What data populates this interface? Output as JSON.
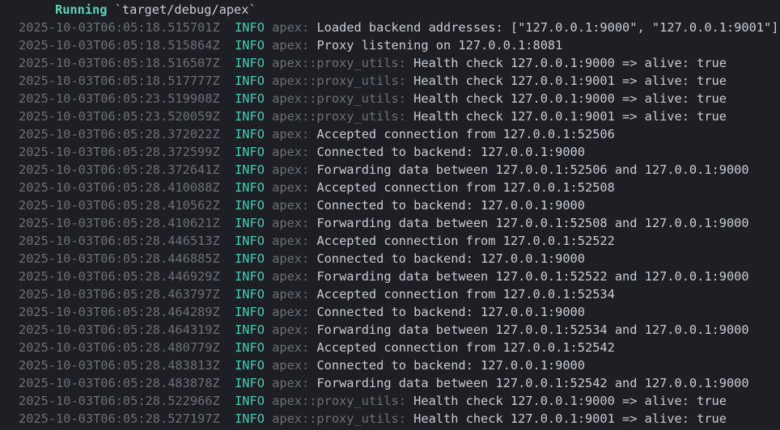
{
  "header": {
    "status": "Running",
    "command": "`target/debug/apex`"
  },
  "logs": [
    {
      "ts": "2025-10-03T06:05:18.515701Z",
      "level": "INFO",
      "target": "apex:",
      "msg": "Loaded backend addresses: [\"127.0.0.1:9000\", \"127.0.0.1:9001\"]"
    },
    {
      "ts": "2025-10-03T06:05:18.515864Z",
      "level": "INFO",
      "target": "apex:",
      "msg": "Proxy listening on 127.0.0.1:8081"
    },
    {
      "ts": "2025-10-03T06:05:18.516507Z",
      "level": "INFO",
      "target": "apex::proxy_utils:",
      "msg": "Health check 127.0.0.1:9000 => alive: true"
    },
    {
      "ts": "2025-10-03T06:05:18.517777Z",
      "level": "INFO",
      "target": "apex::proxy_utils:",
      "msg": "Health check 127.0.0.1:9001 => alive: true"
    },
    {
      "ts": "2025-10-03T06:05:23.519908Z",
      "level": "INFO",
      "target": "apex::proxy_utils:",
      "msg": "Health check 127.0.0.1:9000 => alive: true"
    },
    {
      "ts": "2025-10-03T06:05:23.520059Z",
      "level": "INFO",
      "target": "apex::proxy_utils:",
      "msg": "Health check 127.0.0.1:9001 => alive: true"
    },
    {
      "ts": "2025-10-03T06:05:28.372022Z",
      "level": "INFO",
      "target": "apex:",
      "msg": "Accepted connection from 127.0.0.1:52506"
    },
    {
      "ts": "2025-10-03T06:05:28.372599Z",
      "level": "INFO",
      "target": "apex:",
      "msg": "Connected to backend: 127.0.0.1:9000"
    },
    {
      "ts": "2025-10-03T06:05:28.372641Z",
      "level": "INFO",
      "target": "apex:",
      "msg": "Forwarding data between 127.0.0.1:52506 and 127.0.0.1:9000"
    },
    {
      "ts": "2025-10-03T06:05:28.410088Z",
      "level": "INFO",
      "target": "apex:",
      "msg": "Accepted connection from 127.0.0.1:52508"
    },
    {
      "ts": "2025-10-03T06:05:28.410562Z",
      "level": "INFO",
      "target": "apex:",
      "msg": "Connected to backend: 127.0.0.1:9000"
    },
    {
      "ts": "2025-10-03T06:05:28.410621Z",
      "level": "INFO",
      "target": "apex:",
      "msg": "Forwarding data between 127.0.0.1:52508 and 127.0.0.1:9000"
    },
    {
      "ts": "2025-10-03T06:05:28.446513Z",
      "level": "INFO",
      "target": "apex:",
      "msg": "Accepted connection from 127.0.0.1:52522"
    },
    {
      "ts": "2025-10-03T06:05:28.446885Z",
      "level": "INFO",
      "target": "apex:",
      "msg": "Connected to backend: 127.0.0.1:9000"
    },
    {
      "ts": "2025-10-03T06:05:28.446929Z",
      "level": "INFO",
      "target": "apex:",
      "msg": "Forwarding data between 127.0.0.1:52522 and 127.0.0.1:9000"
    },
    {
      "ts": "2025-10-03T06:05:28.463797Z",
      "level": "INFO",
      "target": "apex:",
      "msg": "Accepted connection from 127.0.0.1:52534"
    },
    {
      "ts": "2025-10-03T06:05:28.464289Z",
      "level": "INFO",
      "target": "apex:",
      "msg": "Connected to backend: 127.0.0.1:9000"
    },
    {
      "ts": "2025-10-03T06:05:28.464319Z",
      "level": "INFO",
      "target": "apex:",
      "msg": "Forwarding data between 127.0.0.1:52534 and 127.0.0.1:9000"
    },
    {
      "ts": "2025-10-03T06:05:28.480779Z",
      "level": "INFO",
      "target": "apex:",
      "msg": "Accepted connection from 127.0.0.1:52542"
    },
    {
      "ts": "2025-10-03T06:05:28.483813Z",
      "level": "INFO",
      "target": "apex:",
      "msg": "Connected to backend: 127.0.0.1:9000"
    },
    {
      "ts": "2025-10-03T06:05:28.483878Z",
      "level": "INFO",
      "target": "apex:",
      "msg": "Forwarding data between 127.0.0.1:52542 and 127.0.0.1:9000"
    },
    {
      "ts": "2025-10-03T06:05:28.522966Z",
      "level": "INFO",
      "target": "apex::proxy_utils:",
      "msg": "Health check 127.0.0.1:9000 => alive: true"
    },
    {
      "ts": "2025-10-03T06:05:28.527197Z",
      "level": "INFO",
      "target": "apex::proxy_utils:",
      "msg": "Health check 127.0.0.1:9001 => alive: true"
    }
  ],
  "colors": {
    "background": "#1e1f24",
    "running": "#5fd0b8",
    "level_info": "#4ec6b4",
    "dim": "#6b7078",
    "text": "#c8ccd4"
  }
}
